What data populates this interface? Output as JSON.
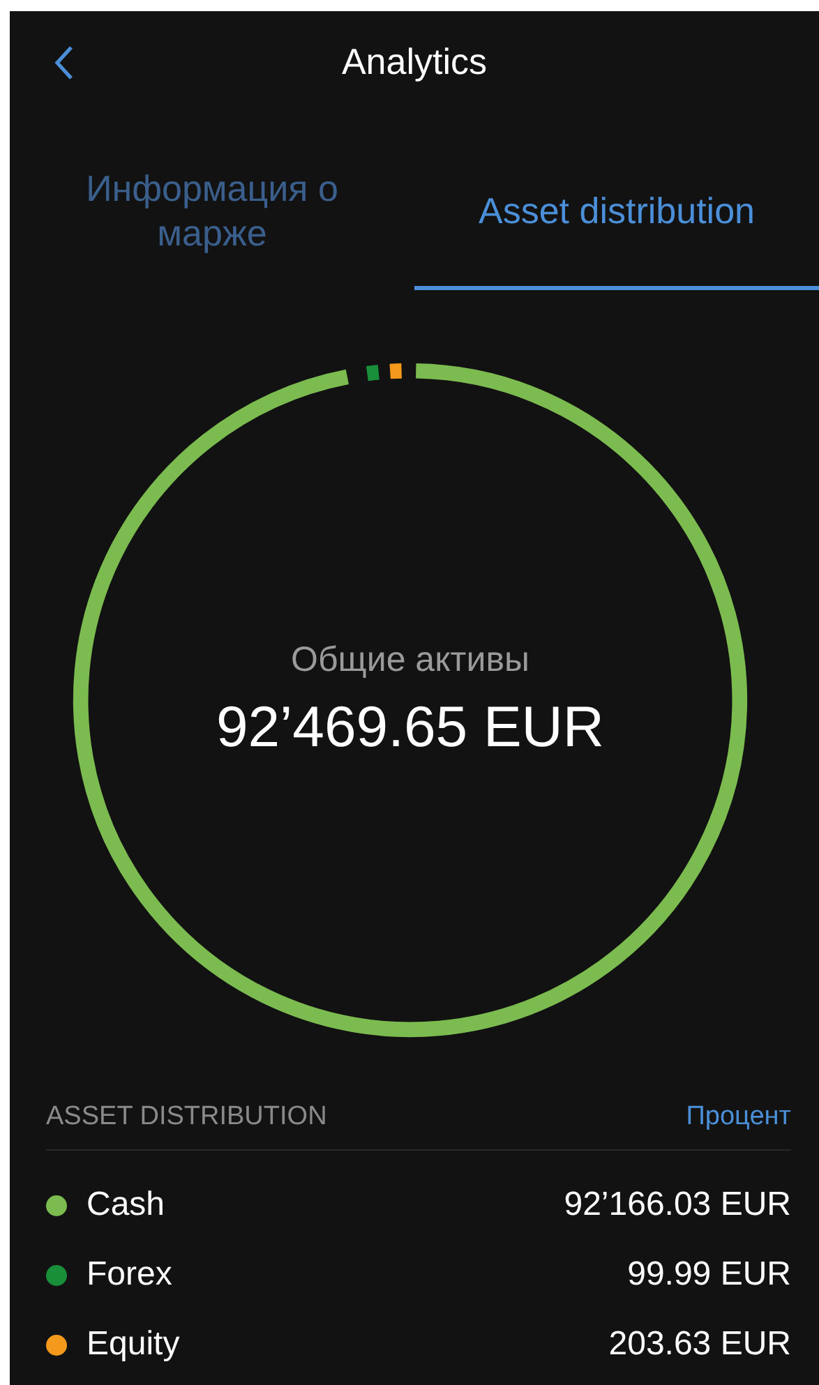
{
  "header": {
    "title": "Analytics"
  },
  "tabs": [
    {
      "label": "Информация о марже",
      "selected": false
    },
    {
      "label": "Asset distribution",
      "selected": true
    }
  ],
  "total": {
    "label": "Общие активы",
    "value": "92’469.65 EUR"
  },
  "distribution": {
    "heading": "ASSET DISTRIBUTION",
    "mode_link": "Процент",
    "items": [
      {
        "name": "Cash",
        "amount": "92’166.03 EUR",
        "color": "#7cbb4f"
      },
      {
        "name": "Forex",
        "amount": "99.99 EUR",
        "color": "#1a8f3a"
      },
      {
        "name": "Equity",
        "amount": "203.63 EUR",
        "color": "#f5991c"
      }
    ]
  }
}
